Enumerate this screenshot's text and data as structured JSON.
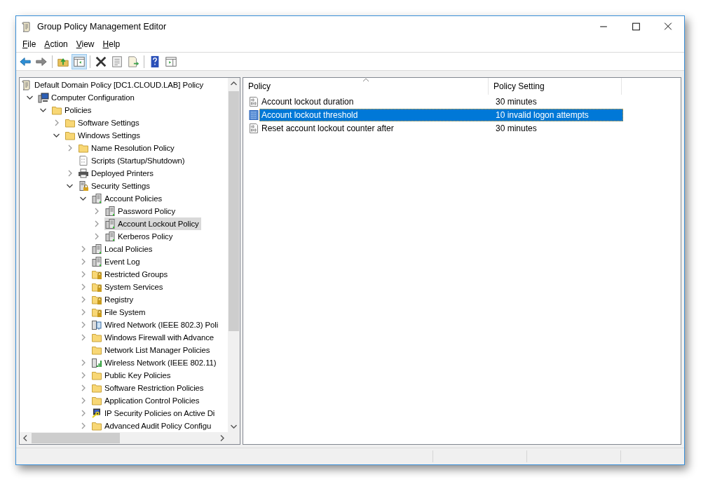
{
  "window": {
    "title": "Group Policy Management Editor"
  },
  "menu": [
    "File",
    "Action",
    "View",
    "Help"
  ],
  "toolbar": [
    [
      {
        "kind": "back",
        "pressed": false
      },
      {
        "kind": "forward",
        "pressed": false
      }
    ],
    [
      {
        "kind": "up",
        "pressed": false
      },
      {
        "kind": "tree",
        "pressed": true
      }
    ],
    [
      {
        "kind": "delete",
        "pressed": false
      },
      {
        "kind": "properties",
        "pressed": false
      },
      {
        "kind": "export",
        "pressed": false
      }
    ],
    [
      {
        "kind": "help",
        "pressed": false
      },
      {
        "kind": "actionpane",
        "pressed": false
      }
    ]
  ],
  "tree": [
    {
      "label": "Default Domain Policy [DC1.CLOUD.LAB] Policy",
      "kind": "scroll",
      "selected": false,
      "children": [
        {
          "label": "Computer Configuration",
          "kind": "computer",
          "expandable": true,
          "expanded": true,
          "selected": false,
          "children": [
            {
              "label": "Policies",
              "kind": "folder",
              "expandable": true,
              "expanded": true,
              "selected": false,
              "children": [
                {
                  "label": "Software Settings",
                  "kind": "folder",
                  "expandable": true,
                  "expanded": false,
                  "selected": false
                },
                {
                  "label": "Windows Settings",
                  "kind": "folder",
                  "expandable": true,
                  "expanded": true,
                  "selected": false,
                  "children": [
                    {
                      "label": "Name Resolution Policy",
                      "kind": "folder",
                      "expandable": true,
                      "expanded": false,
                      "selected": false
                    },
                    {
                      "label": "Scripts (Startup/Shutdown)",
                      "kind": "script",
                      "expandable": false,
                      "selected": false
                    },
                    {
                      "label": "Deployed Printers",
                      "kind": "printer",
                      "expandable": true,
                      "expanded": false,
                      "selected": false
                    },
                    {
                      "label": "Security Settings",
                      "kind": "server-lock",
                      "expandable": true,
                      "expanded": true,
                      "selected": false,
                      "children": [
                        {
                          "label": "Account Policies",
                          "kind": "server",
                          "expandable": true,
                          "expanded": true,
                          "selected": false,
                          "children": [
                            {
                              "label": "Password Policy",
                              "kind": "server",
                              "expandable": true,
                              "expanded": false,
                              "selected": false
                            },
                            {
                              "label": "Account Lockout Policy",
                              "kind": "server",
                              "expandable": true,
                              "expanded": false,
                              "selected": true
                            },
                            {
                              "label": "Kerberos Policy",
                              "kind": "server",
                              "expandable": true,
                              "expanded": false,
                              "selected": false
                            }
                          ]
                        },
                        {
                          "label": "Local Policies",
                          "kind": "server",
                          "expandable": true,
                          "expanded": false,
                          "selected": false
                        },
                        {
                          "label": "Event Log",
                          "kind": "server",
                          "expandable": true,
                          "expanded": false,
                          "selected": false
                        },
                        {
                          "label": "Restricted Groups",
                          "kind": "folder-lock",
                          "expandable": true,
                          "expanded": false,
                          "selected": false
                        },
                        {
                          "label": "System Services",
                          "kind": "folder-lock",
                          "expandable": true,
                          "expanded": false,
                          "selected": false
                        },
                        {
                          "label": "Registry",
                          "kind": "folder-lock",
                          "expandable": true,
                          "expanded": false,
                          "selected": false
                        },
                        {
                          "label": "File System",
                          "kind": "folder-lock",
                          "expandable": true,
                          "expanded": false,
                          "selected": false
                        },
                        {
                          "label": "Wired Network (IEEE 802.3) Poli",
                          "kind": "wired",
                          "expandable": true,
                          "expanded": false,
                          "selected": false
                        },
                        {
                          "label": "Windows Firewall with Advance",
                          "kind": "folder",
                          "expandable": true,
                          "expanded": false,
                          "selected": false
                        },
                        {
                          "label": "Network List Manager Policies",
                          "kind": "folder",
                          "expandable": false,
                          "selected": false
                        },
                        {
                          "label": "Wireless Network (IEEE 802.11)",
                          "kind": "wireless",
                          "expandable": true,
                          "expanded": false,
                          "selected": false
                        },
                        {
                          "label": "Public Key Policies",
                          "kind": "folder",
                          "expandable": true,
                          "expanded": false,
                          "selected": false
                        },
                        {
                          "label": "Software Restriction Policies",
                          "kind": "folder",
                          "expandable": true,
                          "expanded": false,
                          "selected": false
                        },
                        {
                          "label": "Application Control Policies",
                          "kind": "folder",
                          "expandable": true,
                          "expanded": false,
                          "selected": false
                        },
                        {
                          "label": "IP Security Policies on Active Di",
                          "kind": "ipsec",
                          "expandable": true,
                          "expanded": false,
                          "selected": false
                        },
                        {
                          "label": "Advanced Audit Policy Configu",
                          "kind": "folder",
                          "expandable": true,
                          "expanded": false,
                          "selected": false
                        }
                      ]
                    }
                  ]
                }
              ]
            }
          ]
        }
      ]
    }
  ],
  "table": {
    "columns": [
      {
        "label": "Policy",
        "sorted": true
      },
      {
        "label": "Policy Setting",
        "sorted": false
      }
    ],
    "rows": [
      {
        "policy": "Account lockout duration",
        "setting": "30 minutes",
        "selected": false
      },
      {
        "policy": "Account lockout threshold",
        "setting": "10 invalid logon attempts",
        "selected": true
      },
      {
        "policy": "Reset account lockout counter after",
        "setting": "30 minutes",
        "selected": false
      }
    ]
  }
}
